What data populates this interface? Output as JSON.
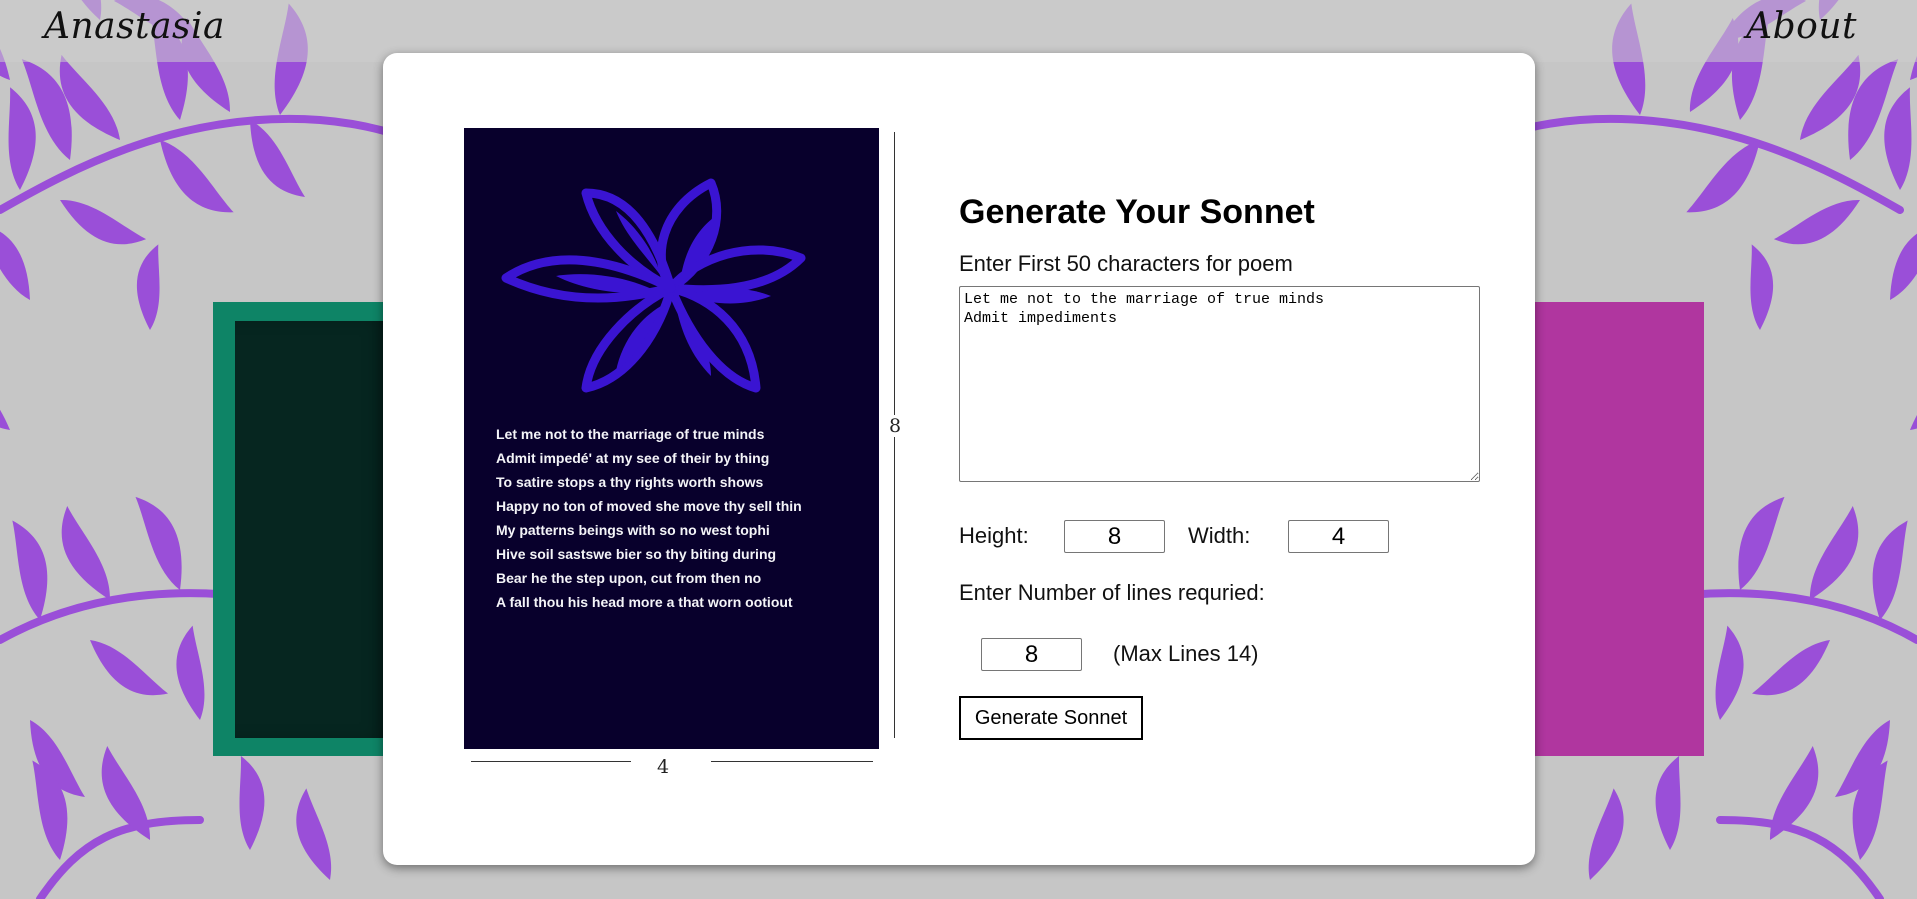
{
  "nav": {
    "brand": "Anastasia",
    "about": "About"
  },
  "preview": {
    "poem_lines": [
      "Let me not to the marriage of true minds",
      "Admit impedé' at my see of their by thing",
      "To satire stops a thy rights worth shows",
      "Happy no ton of moved she move thy sell thin",
      "My patterns beings with so no west tophi",
      "Hive soil sastswe bier so thy biting during",
      "Bear he the step upon, cut from then no",
      "A fall thou his head more a that worn ootiout"
    ],
    "height_dim": "8",
    "width_dim": "4"
  },
  "form": {
    "title": "Generate Your Sonnet",
    "prompt_label": "Enter First 50 characters for poem",
    "prompt_value": "Let me not to the marriage of true minds\nAdmit impediments",
    "height_label": "Height:",
    "height_value": "8",
    "width_label": "Width:",
    "width_value": "4",
    "lines_label": "Enter Number of lines requried:",
    "lines_value": "8",
    "max_lines_note": "(Max Lines 14)",
    "generate_label": "Generate Sonnet"
  },
  "colors": {
    "page_bg": "#c6c6c6",
    "leaf": "#9a4fd8",
    "preview_bg": "#08002c",
    "flower": "#3a14d2",
    "deco_green": "#0e8466",
    "deco_magenta": "#b0369f"
  }
}
